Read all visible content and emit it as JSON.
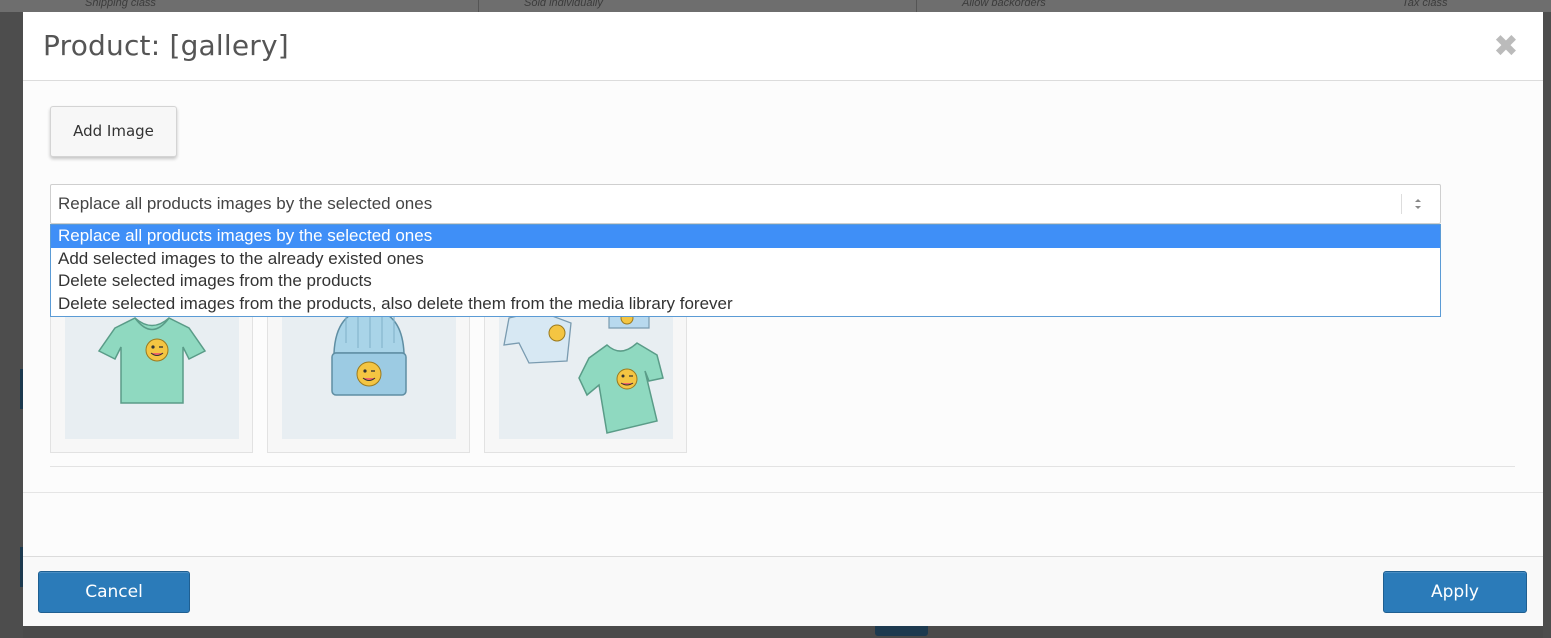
{
  "background": {
    "columns": [
      "Shipping class",
      "Sold individually",
      "Allow backorders",
      "Tax class"
    ]
  },
  "modal": {
    "title": "Product: [gallery]",
    "close_icon": "close-icon",
    "add_image_label": "Add Image",
    "mode_select": {
      "selected_value": "Replace all products images by the selected ones",
      "options": [
        "Replace all products images by the selected ones",
        "Add selected images to the already existed ones",
        "Delete selected images from the products",
        "Delete selected images from the products, also delete them from the media library forever"
      ],
      "highlighted_index": 0
    },
    "gallery": [
      "tshirt-image",
      "beanie-image",
      "hoodie-and-tshirt-image"
    ],
    "footer": {
      "cancel_label": "Cancel",
      "apply_label": "Apply"
    }
  },
  "colors": {
    "primary": "#2b7bb9",
    "option_highlight": "#3f8ff7",
    "shirt": "#8fd9c0",
    "hat": "#a9d4e8",
    "emoji": "#f4c542"
  }
}
